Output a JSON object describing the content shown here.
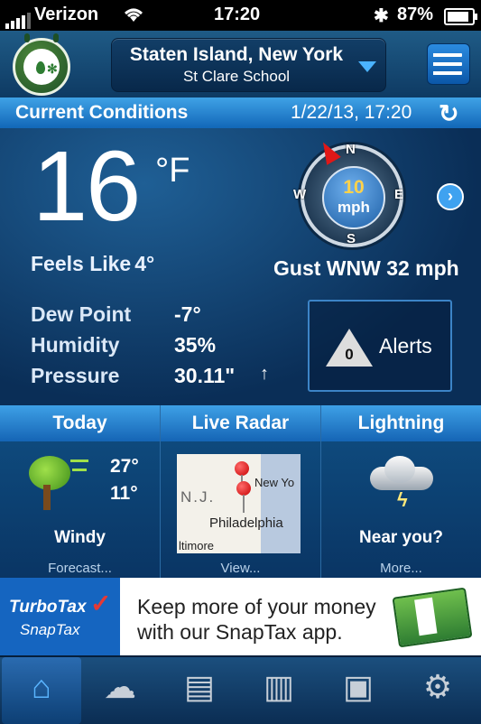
{
  "status_bar": {
    "carrier": "Verizon",
    "time": "17:20",
    "battery_percent": "87%",
    "battery_level": 0.87
  },
  "header": {
    "location_city": "Staten Island, New York",
    "location_station": "St Clare School"
  },
  "current_conditions": {
    "title": "Current Conditions",
    "datetime": "1/22/13, 17:20",
    "temperature": "16",
    "temp_unit": "°F",
    "feels_like_label": "Feels Like",
    "feels_like_value": "4°",
    "wind": {
      "speed": "10",
      "unit": "mph",
      "gust": "Gust WNW 32 mph",
      "compass": {
        "n": "N",
        "s": "S",
        "e": "E",
        "w": "W"
      }
    },
    "metrics": [
      {
        "label": "Dew Point",
        "value": "-7°"
      },
      {
        "label": "Humidity",
        "value": "35%"
      },
      {
        "label": "Pressure",
        "value": "30.11\"",
        "trend": "↑"
      }
    ],
    "alerts": {
      "count": "0",
      "label": "Alerts"
    }
  },
  "tiles": {
    "today": {
      "title": "Today",
      "high": "27°",
      "low": "11°",
      "condition": "Windy",
      "link": "Forecast..."
    },
    "radar": {
      "title": "Live Radar",
      "link": "View...",
      "map_labels": {
        "nj": "N.J.",
        "ny": "New Yo",
        "philadelphia": "Philadelphia",
        "baltimore": "ltimore"
      }
    },
    "lightning": {
      "title": "Lightning",
      "status": "Near you?",
      "link": "More..."
    }
  },
  "ad": {
    "brand_line1": "TurboTax",
    "brand_line2": "SnapTax",
    "copy_line1": "Keep more of your money",
    "copy_line2": "with our SnapTax app."
  },
  "tabbar": {
    "tabs": [
      {
        "name": "home",
        "icon": "home-icon"
      },
      {
        "name": "forecast",
        "icon": "weather-icon"
      },
      {
        "name": "notebook",
        "icon": "notebook-icon"
      },
      {
        "name": "maps",
        "icon": "map-icon"
      },
      {
        "name": "camera",
        "icon": "camera-icon"
      },
      {
        "name": "settings",
        "icon": "gear-icon"
      }
    ]
  },
  "colors": {
    "accent": "#1e7fd6",
    "header_bar": "#3fa2e6",
    "panel": "#0a2e57"
  }
}
